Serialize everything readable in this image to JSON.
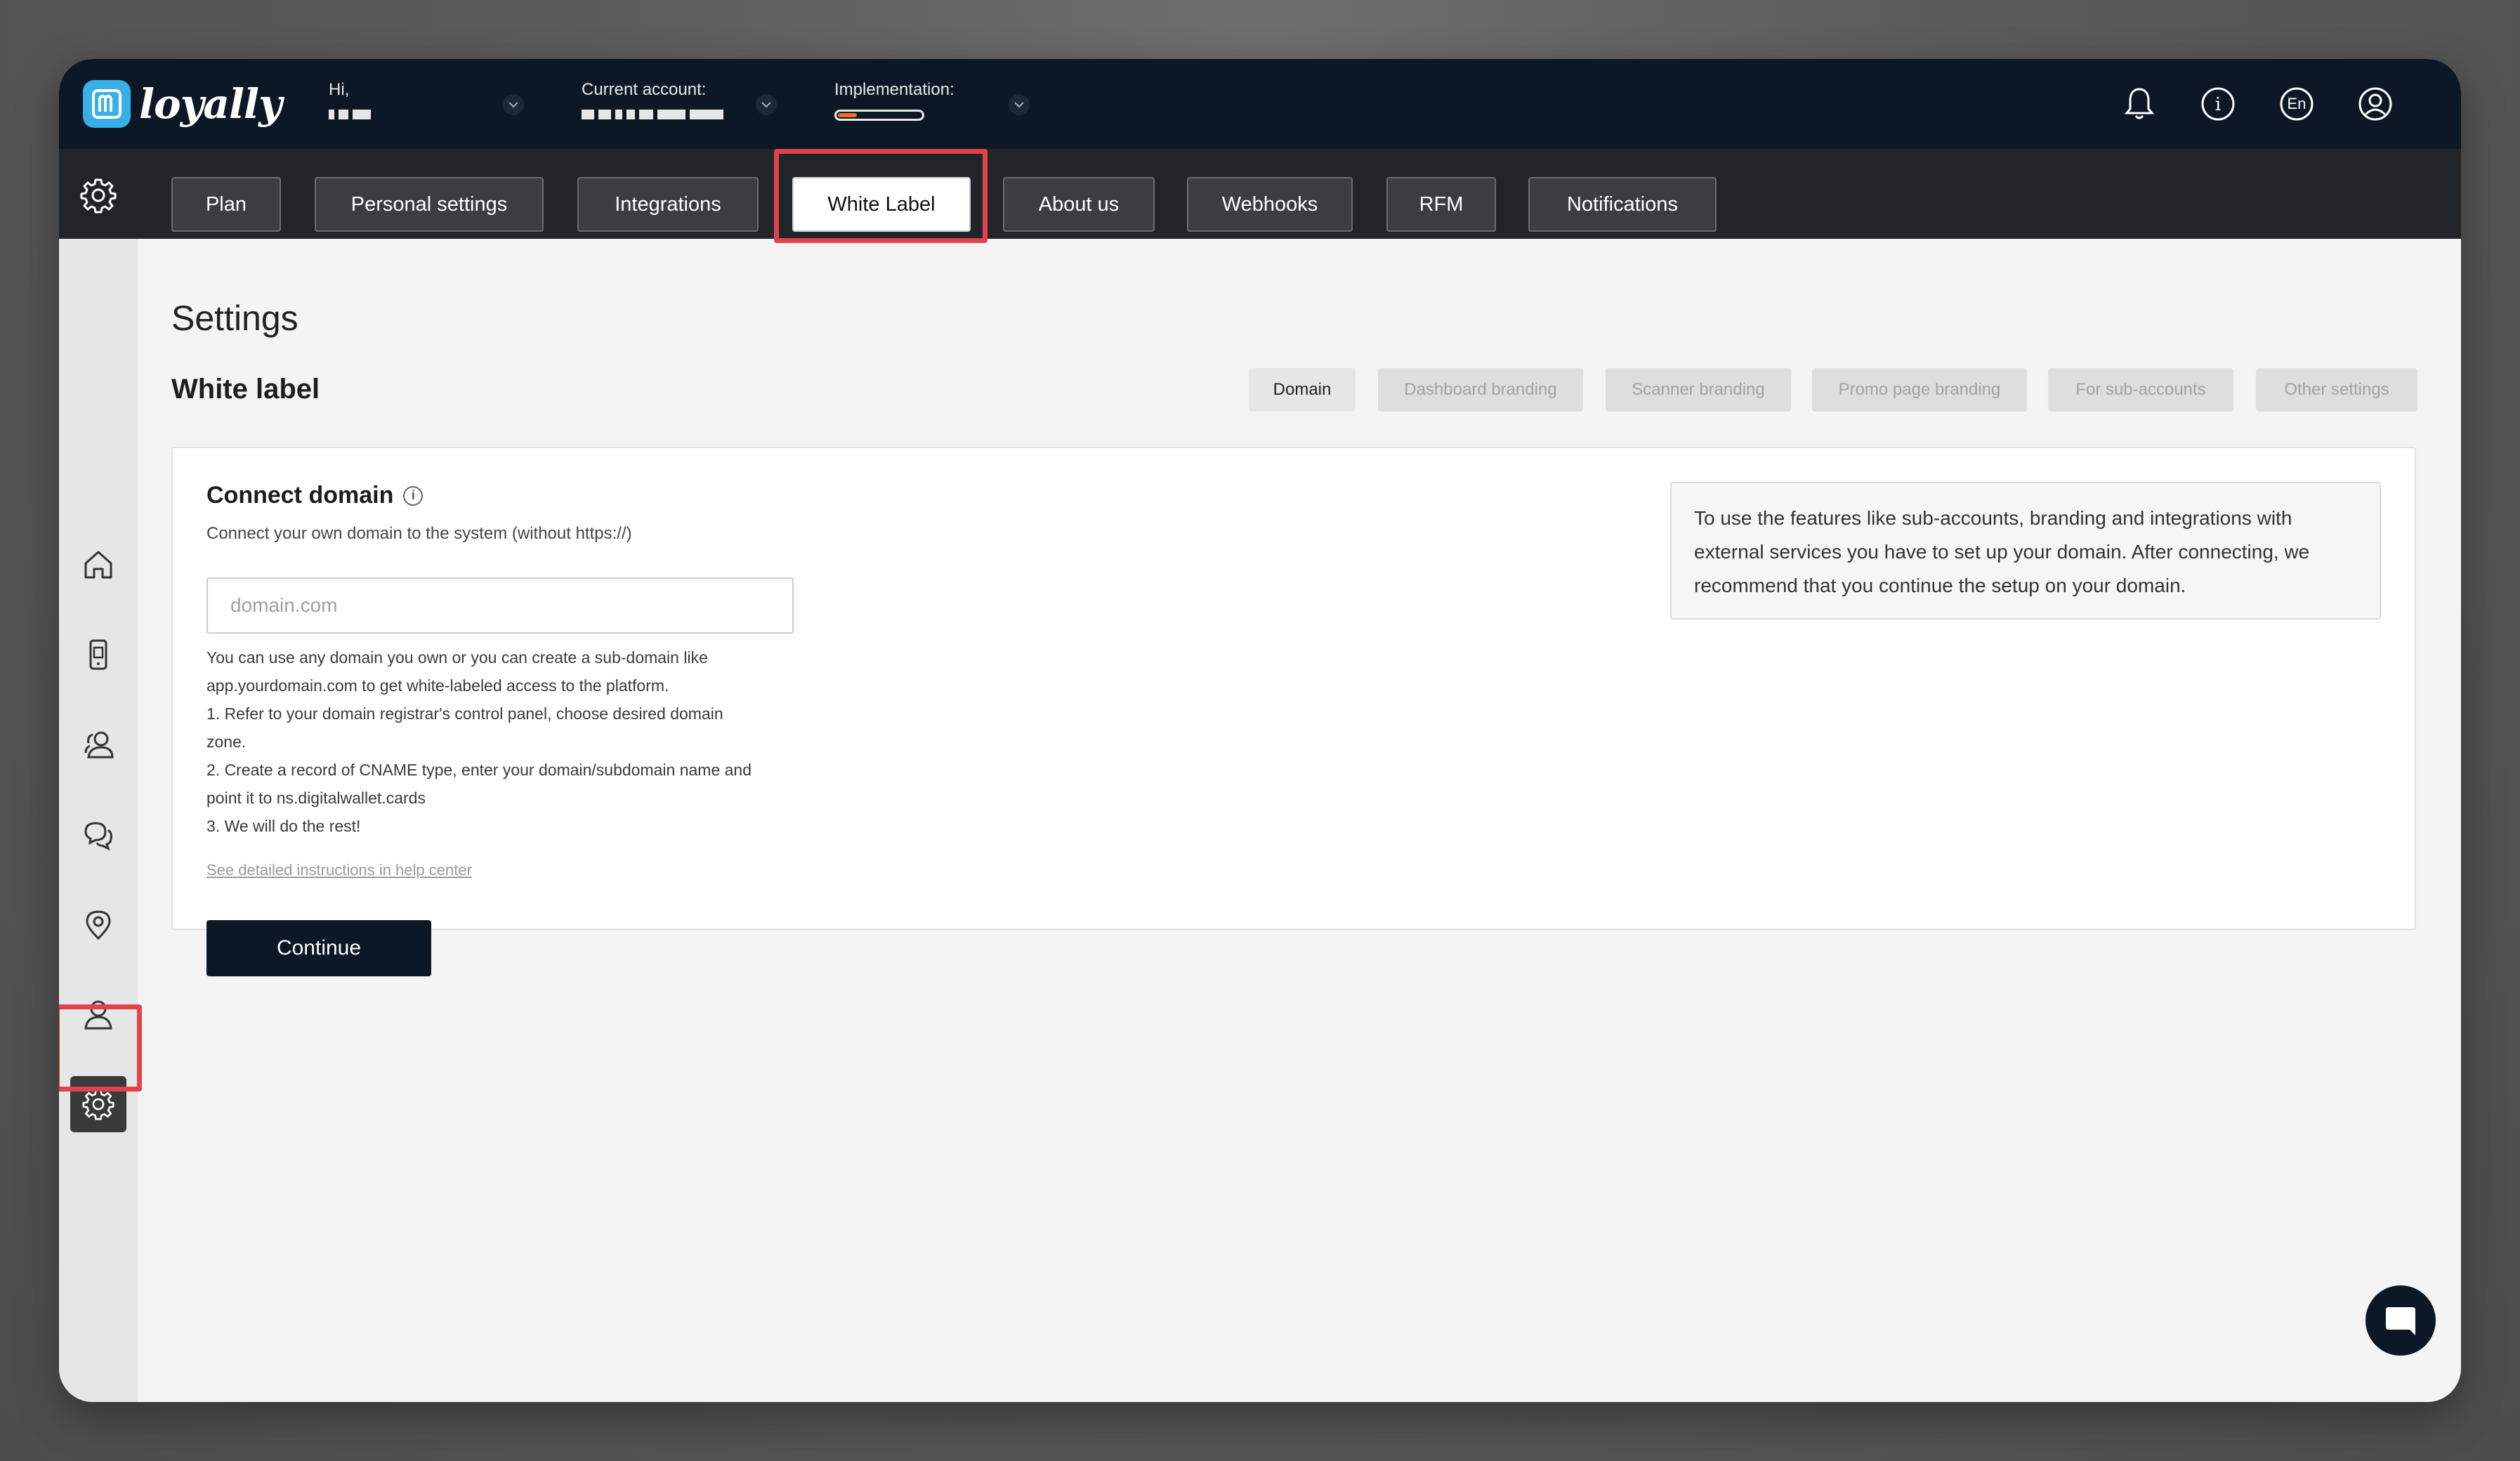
{
  "brand": {
    "logo_text": "loyally",
    "logo_mark": "m",
    "accent": "#38b0e6"
  },
  "header": {
    "greeting_label": "Hi,",
    "current_account_label": "Current account:",
    "implementation_label": "Implementation:",
    "implementation_progress": 0.22,
    "icons": [
      "bell-icon",
      "info-icon",
      "language-icon",
      "profile-icon"
    ],
    "language": "En"
  },
  "tabs": {
    "items": [
      {
        "label": "Plan"
      },
      {
        "label": "Personal settings"
      },
      {
        "label": "Integrations"
      },
      {
        "label": "White Label",
        "active": true
      },
      {
        "label": "About us"
      },
      {
        "label": "Webhooks"
      },
      {
        "label": "RFM"
      },
      {
        "label": "Notifications"
      }
    ]
  },
  "sidebar": {
    "items": [
      "home-icon",
      "mobile-card-icon",
      "customers-icon",
      "messages-icon",
      "location-icon",
      "user-icon",
      "settings-icon"
    ],
    "active": "settings-icon"
  },
  "main": {
    "page_title": "Settings",
    "section_title": "White label",
    "subtabs": [
      {
        "label": "Domain",
        "active": true
      },
      {
        "label": "Dashboard branding"
      },
      {
        "label": "Scanner branding"
      },
      {
        "label": "Promo page branding"
      },
      {
        "label": "For sub-accounts"
      },
      {
        "label": "Other settings"
      }
    ]
  },
  "card": {
    "title": "Connect domain",
    "subtitle": "Connect your own domain to the system (without https://)",
    "input_placeholder": "domain.com",
    "help_lines": [
      "You can use any domain you own or you can create a sub-domain like",
      "app.yourdomain.com to get white-labeled access to the platform.",
      "1. Refer to your domain registrar's control panel, choose desired domain",
      "zone.",
      "2. Create a record of CNAME type, enter your domain/subdomain name and",
      "point it to ns.digitalwallet.cards",
      "3. We will do the rest!"
    ],
    "help_link": "See detailed instructions in help center",
    "continue_label": "Continue",
    "note": "To use the features like sub-accounts, branding and integrations with external services you have to set up your domain. After connecting, we recommend that you continue the setup on your domain."
  },
  "colors": {
    "header_bg": "#0c1826",
    "tabbar_bg": "#222527",
    "highlight": "#e0434b",
    "progress": "#f26a2c"
  }
}
